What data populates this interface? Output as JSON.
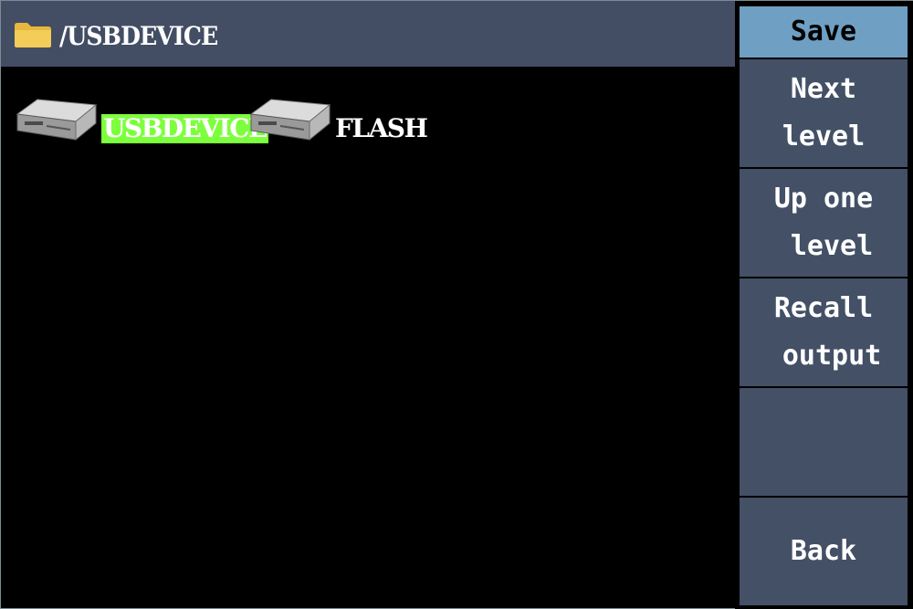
{
  "titlebar": {
    "path": "/USBDEVICE",
    "folder_icon": "folder-icon"
  },
  "drives": [
    {
      "label": "USBDEVICE",
      "icon": "drive-icon",
      "selected": true
    },
    {
      "label": "FLASH",
      "icon": "drive-icon",
      "selected": false
    }
  ],
  "menu": {
    "save": "Save",
    "next_level_1": "Next",
    "next_level_2": "level",
    "up_one_level_1": "Up one",
    "up_one_level_2": " level",
    "recall_output_1": "Recall",
    "recall_output_2": " output",
    "empty": "",
    "back": "Back"
  },
  "colors": {
    "titlebar_bg": "#434e64",
    "menu_bg": "#435066",
    "menu_active_bg": "#6fa0c3",
    "selection_highlight": "#7cff3c",
    "screen_bg": "#000000"
  }
}
